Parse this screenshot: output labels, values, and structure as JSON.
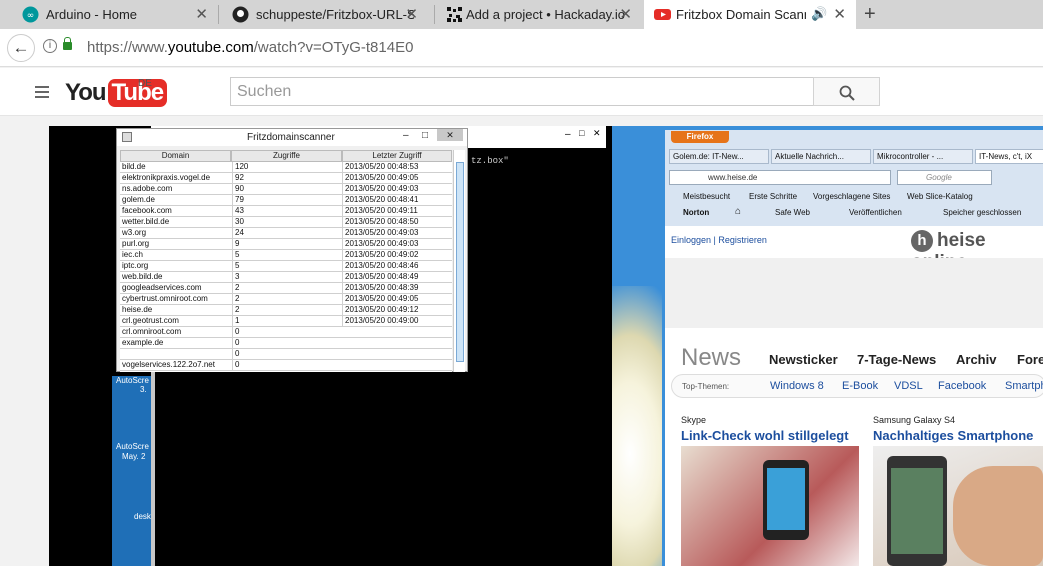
{
  "browser": {
    "tabs": [
      {
        "label": "Arduino - Home",
        "icon": "arduino-icon"
      },
      {
        "label": "schuppeste/Fritzbox-URL-Sp",
        "icon": "github-icon"
      },
      {
        "label": "Add a project • Hackaday.io",
        "icon": "hackaday-icon"
      },
      {
        "label": "Fritzbox Domain Scanner",
        "icon": "youtube-icon",
        "active": true
      }
    ],
    "close_glyph": "✕",
    "new_tab_glyph": "+",
    "url_prefix": "https://www.",
    "url_host": "youtube.com",
    "url_path": "/watch?v=OTyG-t814E0"
  },
  "youtube": {
    "logo_you": "You",
    "logo_tube": "Tube",
    "region": "DE",
    "search_placeholder": "Suchen"
  },
  "scanner": {
    "title": "Fritzdomainscanner",
    "columns": [
      "Domain",
      "Zugriffe",
      "Letzter Zugriff"
    ],
    "rows": [
      [
        "bild.de",
        "120",
        "2013/05/20 00:48:53"
      ],
      [
        "elektronikpraxis.vogel.de",
        "92",
        "2013/05/20 00:49:05"
      ],
      [
        "ns.adobe.com",
        "90",
        "2013/05/20 00:49:03"
      ],
      [
        "golem.de",
        "79",
        "2013/05/20 00:48:41"
      ],
      [
        "facebook.com",
        "43",
        "2013/05/20 00:49:11"
      ],
      [
        "wetter.bild.de",
        "30",
        "2013/05/20 00:48:50"
      ],
      [
        "w3.org",
        "24",
        "2013/05/20 00:49:03"
      ],
      [
        "purl.org",
        "9",
        "2013/05/20 00:49:03"
      ],
      [
        "iec.ch",
        "5",
        "2013/05/20 00:49:02"
      ],
      [
        "iptc.org",
        "5",
        "2013/05/20 00:48:46"
      ],
      [
        "web.bild.de",
        "3",
        "2013/05/20 00:48:49"
      ],
      [
        "googleadservices.com",
        "2",
        "2013/05/20 00:48:39"
      ],
      [
        "cybertrust.omniroot.com",
        "2",
        "2013/05/20 00:49:05"
      ],
      [
        "heise.de",
        "2",
        "2013/05/20 00:49:12"
      ],
      [
        "crl.geotrust.com",
        "1",
        "2013/05/20 00:49:00"
      ],
      [
        "crl.omniroot.com",
        "0",
        ""
      ],
      [
        "example.de",
        "0",
        ""
      ],
      [
        "",
        "0",
        ""
      ],
      [
        "vogelservices.122.2o7.net",
        "0",
        ""
      ]
    ],
    "console_text": "tz.box\"",
    "desktop_labels": [
      "AutoScre",
      "3.",
      "AutoScre",
      "May. 2",
      "desk"
    ]
  },
  "firefox": {
    "button": "Firefox",
    "tabs": [
      "Golem.de: IT-New...",
      "Aktuelle Nachrich...",
      "Mikrocontroller - ...",
      "IT-News, c't, iX"
    ],
    "url": "www.heise.de",
    "search_placeholder": "Google",
    "bookmarks1": [
      "Meistbesucht",
      "Erste Schritte",
      "Vorgeschlagene Sites",
      "Web Slice-Katalog"
    ],
    "bookmarks2": [
      "Norton",
      "Safe Web",
      "Veröffentlichen",
      "Speicher geschlossen"
    ],
    "login": "Einloggen | Registrieren",
    "heise_logo": "heise online",
    "news_word": "News",
    "nav": [
      "Newsticker",
      "7-Tage-News",
      "Archiv",
      "Foren"
    ],
    "top_label": "Top-Themen:",
    "top_themes": [
      "Windows 8",
      "E-Book",
      "VDSL",
      "Facebook",
      "Smartph"
    ],
    "articles": [
      {
        "category": "Skype",
        "headline": "Link-Check wohl stillgelegt"
      },
      {
        "category": "Samsung Galaxy S4",
        "headline": "Nachhaltiges Smartphone"
      }
    ]
  }
}
